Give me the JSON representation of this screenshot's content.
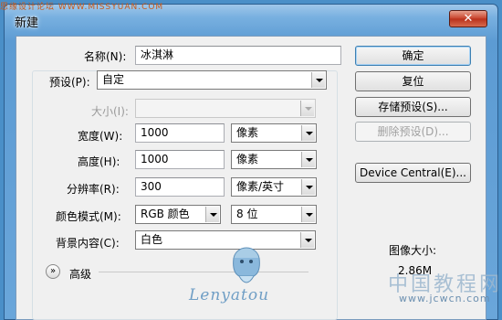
{
  "window": {
    "title": "新建",
    "close_glyph": "✕",
    "watermark_top": "思缘设计论坛 WWW.MISSYUAN.COM"
  },
  "form": {
    "name": {
      "label": "名称(N):",
      "value": "冰淇淋"
    },
    "preset": {
      "label": "预设(P):",
      "value": "自定"
    },
    "size": {
      "label": "大小(I):",
      "value": ""
    },
    "width": {
      "label": "宽度(W):",
      "value": "1000",
      "unit": "像素"
    },
    "height": {
      "label": "高度(H):",
      "value": "1000",
      "unit": "像素"
    },
    "resolution": {
      "label": "分辨率(R):",
      "value": "300",
      "unit": "像素/英寸"
    },
    "color_mode": {
      "label": "颜色模式(M):",
      "value": "RGB 颜色",
      "depth": "8 位"
    },
    "background": {
      "label": "背景内容(C):",
      "value": "白色"
    },
    "advanced": {
      "label": "高级",
      "icon": "chevron-double-down-icon"
    }
  },
  "buttons": {
    "ok": "确定",
    "reset": "复位",
    "save_preset": "存储预设(S)...",
    "delete_preset": "删除预设(D)...",
    "device_central": "Device Central(E)..."
  },
  "image_size": {
    "label": "图像大小:",
    "value": "2.86M"
  },
  "overlay": {
    "signature": "Lenyatou",
    "wm_cn": "中国教程网",
    "wm_url": "www.jcwcn.com"
  },
  "colors": {
    "titlebar": "#78b0e0",
    "close_button": "#c7412a",
    "client_bg": "#f0f0f0"
  }
}
